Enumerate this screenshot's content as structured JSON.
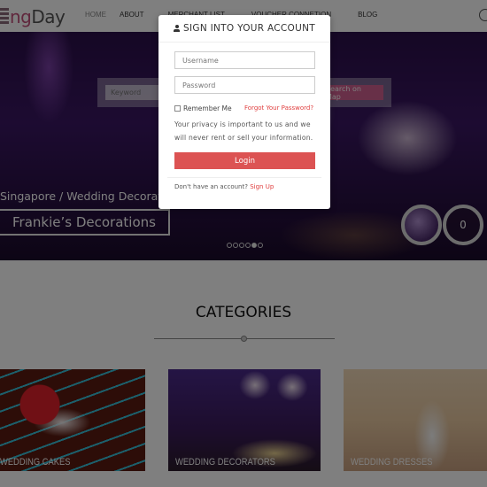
{
  "header": {
    "logo": {
      "prefix": "ng",
      "suffix": "Day"
    },
    "nav": [
      {
        "label": "HOME"
      },
      {
        "label": "ABOUT"
      },
      {
        "label": "MERCHANT LIST"
      },
      {
        "label": "VOUCHER CONNETION"
      },
      {
        "label": "BLOG"
      }
    ]
  },
  "hero": {
    "search": {
      "keyword_placeholder": "Keyword",
      "map_button": "Search on Map"
    },
    "subtitle": "Singapore / Wedding Decorators",
    "title": "Frankie’s Decorations",
    "carousel": {
      "total_slides": 6,
      "active_slide": 5
    },
    "count": "0"
  },
  "categories": {
    "title": "CATEGORIES",
    "items": [
      {
        "label": "WEDDING CAKES"
      },
      {
        "label": "WEDDING DECORATORS"
      },
      {
        "label": "WEDDING DRESSES"
      }
    ]
  },
  "modal": {
    "title": "SIGN INTO YOUR ACCOUNT",
    "username_placeholder": "Username",
    "password_placeholder": "Password",
    "remember_label": "Remember Me",
    "forgot_link": "Forgot Your Password?",
    "privacy_text": "Your privacy is important to us and we will never rent or sell your information.",
    "login_button": "Login",
    "signup_prompt": "Don't have an account?",
    "signup_link": "Sign Up"
  },
  "colors": {
    "accent_red": "#dc5353",
    "link_red": "#e04040",
    "brand_pink": "#c0507a"
  }
}
